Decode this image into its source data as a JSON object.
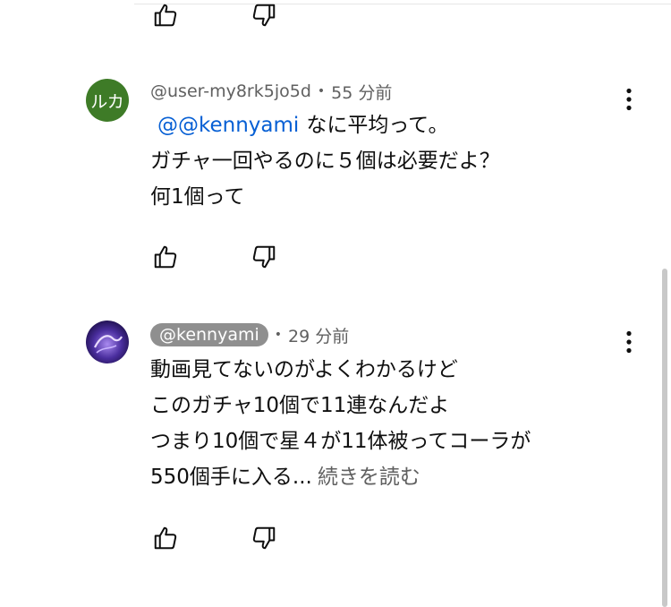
{
  "comments": [
    {
      "avatar_initials": "ルカ",
      "avatar_color": "#3e7b27",
      "author": "@user-my8rk5jo5d",
      "time": "55 分前",
      "mention": "@@kennyami",
      "lines": [
        "なに平均って。",
        "ガチャ一回やるのに５個は必要だよ？",
        "何1個って"
      ]
    },
    {
      "author": "@kennyami",
      "time": "29 分前",
      "lines": [
        "動画見てないのがよくわかるけど",
        "このガチャ10個で11連なんだよ",
        "つまり10個で星４が11体被ってコーラが",
        "550個手に入る..."
      ],
      "read_more": "続きを読む"
    }
  ],
  "icons": {
    "like": "thumb-up-icon",
    "dislike": "thumb-down-icon",
    "menu": "more-vert-icon"
  },
  "colors": {
    "mention": "#065fd4",
    "secondary_text": "#606060",
    "handle_pill": "#8f8f8f"
  }
}
